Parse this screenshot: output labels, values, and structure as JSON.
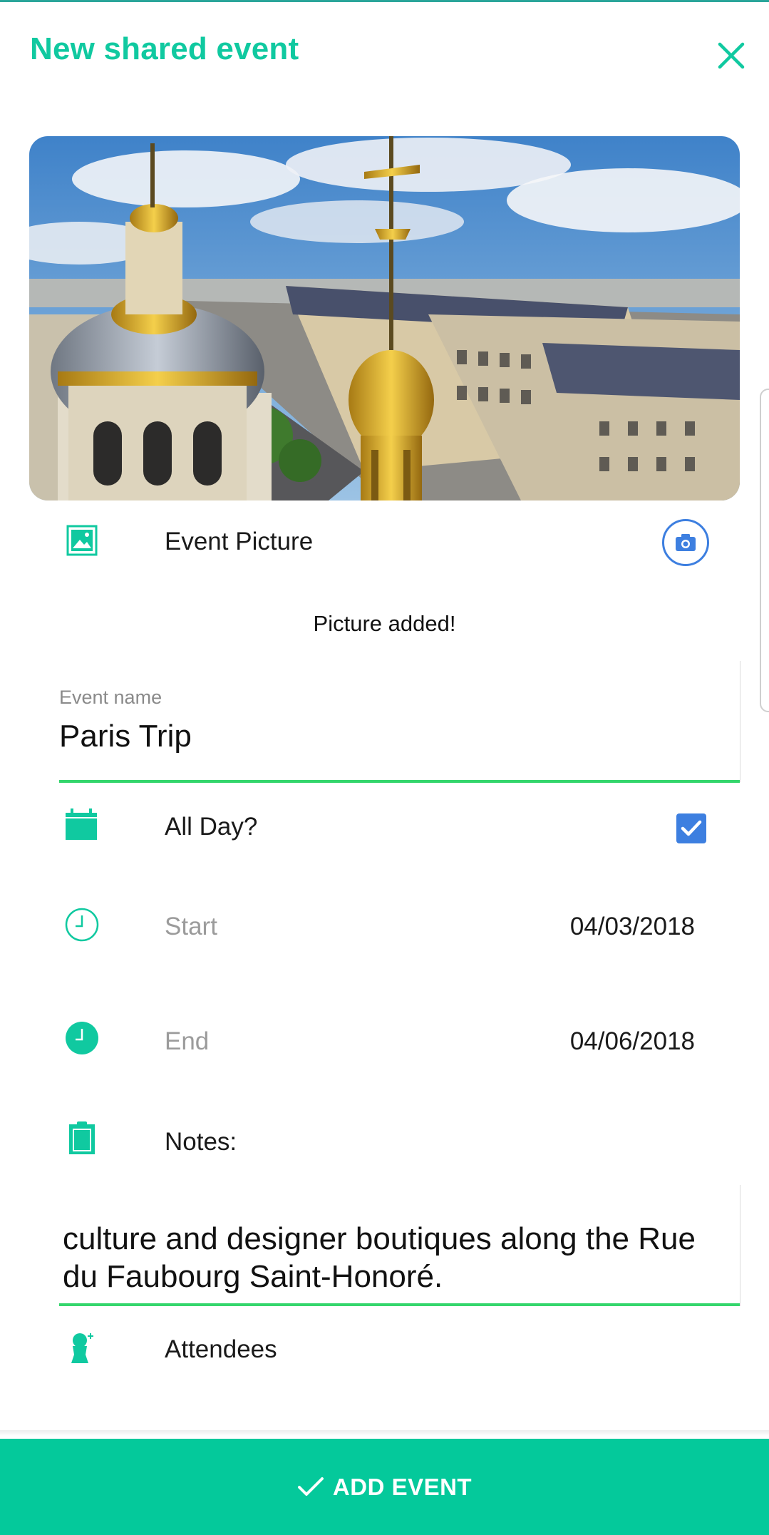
{
  "header": {
    "title": "New shared event",
    "close_icon": "close-icon"
  },
  "colors": {
    "accent": "#10c9a0",
    "button_bg": "#04c99b",
    "underline": "#34d66c",
    "checkbox": "#3d7fe0"
  },
  "picture": {
    "label": "Event Picture",
    "status": "Picture added!",
    "camera_icon": "camera-icon"
  },
  "event_name": {
    "label": "Event name",
    "value": "Paris Trip"
  },
  "all_day": {
    "label": "All Day?",
    "checked": true
  },
  "start": {
    "label": "Start",
    "value": "04/03/2018"
  },
  "end": {
    "label": "End",
    "value": "04/06/2018"
  },
  "notes": {
    "label": "Notes:",
    "value": "culture and designer boutiques along the Rue du Faubourg Saint-Honoré."
  },
  "attendees": {
    "label": "Attendees"
  },
  "footer": {
    "add_label": "ADD EVENT"
  }
}
